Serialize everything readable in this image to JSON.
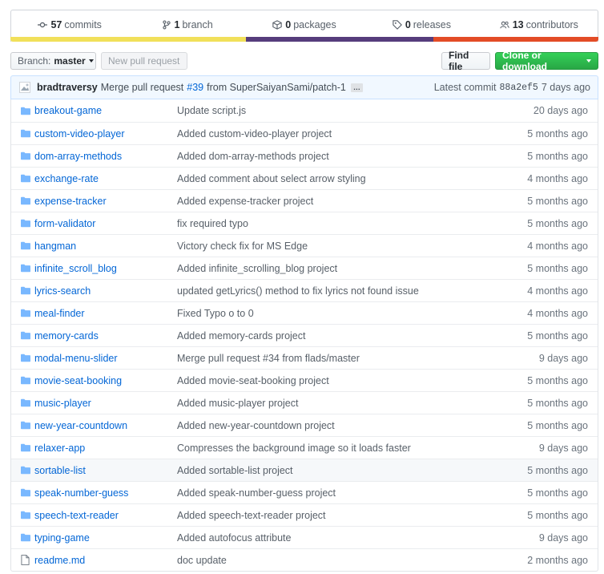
{
  "summary": {
    "commits": {
      "count": "57",
      "label": "commits"
    },
    "branches": {
      "count": "1",
      "label": "branch"
    },
    "packages": {
      "count": "0",
      "label": "packages"
    },
    "releases": {
      "count": "0",
      "label": "releases"
    },
    "contributors": {
      "count": "13",
      "label": "contributors"
    }
  },
  "language_bar": [
    {
      "color": "#f1e05a",
      "fraction": 0.4
    },
    {
      "color": "#563d7c",
      "fraction": 0.32
    },
    {
      "color": "#e34c26",
      "fraction": 0.28
    }
  ],
  "toolbar": {
    "branch_label": "Branch:",
    "branch_value": "master",
    "new_pr_label": "New pull request",
    "find_file_label": "Find file",
    "clone_label": "Clone or download"
  },
  "commit": {
    "author": "bradtraversy",
    "message_prefix": "Merge pull request",
    "pr_link": "#39",
    "message_suffix": "from SuperSaiyanSami/patch-1",
    "ellipsis": "…",
    "latest_label": "Latest commit",
    "sha": "88a2ef5",
    "age": "7 days ago"
  },
  "files": [
    {
      "type": "dir",
      "name": "breakout-game",
      "message": "Update script.js",
      "age": "20 days ago"
    },
    {
      "type": "dir",
      "name": "custom-video-player",
      "message": "Added custom-video-player project",
      "age": "5 months ago"
    },
    {
      "type": "dir",
      "name": "dom-array-methods",
      "message": "Added dom-array-methods project",
      "age": "5 months ago"
    },
    {
      "type": "dir",
      "name": "exchange-rate",
      "message": "Added comment about select arrow styling",
      "age": "4 months ago"
    },
    {
      "type": "dir",
      "name": "expense-tracker",
      "message": "Added expense-tracker project",
      "age": "5 months ago"
    },
    {
      "type": "dir",
      "name": "form-validator",
      "message": "fix required typo",
      "age": "5 months ago"
    },
    {
      "type": "dir",
      "name": "hangman",
      "message": "Victory check fix for MS Edge",
      "age": "4 months ago"
    },
    {
      "type": "dir",
      "name": "infinite_scroll_blog",
      "message": "Added infinite_scrolling_blog project",
      "age": "5 months ago"
    },
    {
      "type": "dir",
      "name": "lyrics-search",
      "message": "updated getLyrics() method to fix lyrics not found issue",
      "age": "4 months ago"
    },
    {
      "type": "dir",
      "name": "meal-finder",
      "message": "Fixed Typo o to 0",
      "age": "4 months ago"
    },
    {
      "type": "dir",
      "name": "memory-cards",
      "message": "Added memory-cards project",
      "age": "5 months ago"
    },
    {
      "type": "dir",
      "name": "modal-menu-slider",
      "message": "Merge pull request #34 from flads/master",
      "age": "9 days ago"
    },
    {
      "type": "dir",
      "name": "movie-seat-booking",
      "message": "Added movie-seat-booking project",
      "age": "5 months ago"
    },
    {
      "type": "dir",
      "name": "music-player",
      "message": "Added music-player project",
      "age": "5 months ago"
    },
    {
      "type": "dir",
      "name": "new-year-countdown",
      "message": "Added new-year-countdown project",
      "age": "5 months ago"
    },
    {
      "type": "dir",
      "name": "relaxer-app",
      "message": "Compresses the background image so it loads faster",
      "age": "9 days ago"
    },
    {
      "type": "dir",
      "name": "sortable-list",
      "message": "Added sortable-list project",
      "age": "5 months ago"
    },
    {
      "type": "dir",
      "name": "speak-number-guess",
      "message": "Added speak-number-guess project",
      "age": "5 months ago"
    },
    {
      "type": "dir",
      "name": "speech-text-reader",
      "message": "Added speech-text-reader project",
      "age": "5 months ago"
    },
    {
      "type": "dir",
      "name": "typing-game",
      "message": "Added autofocus attribute",
      "age": "9 days ago"
    },
    {
      "type": "file",
      "name": "readme.md",
      "message": "doc update",
      "age": "2 months ago"
    }
  ]
}
